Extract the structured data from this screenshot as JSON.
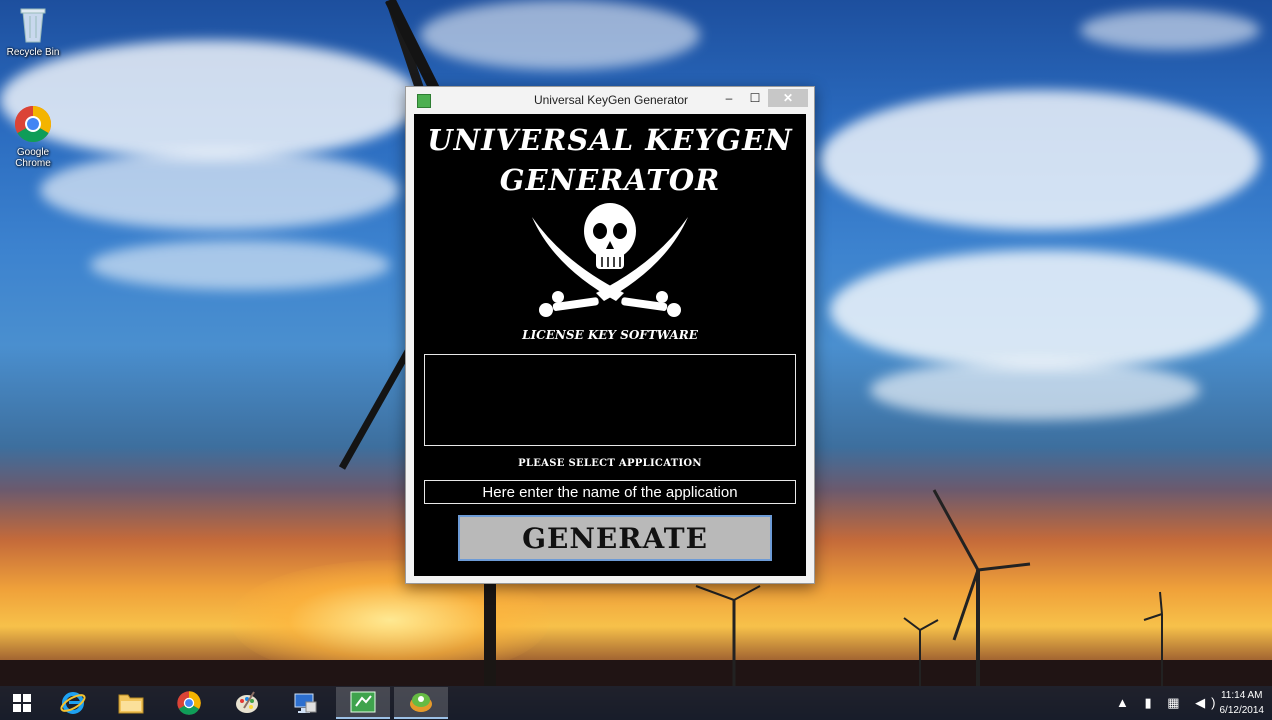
{
  "desktop": {
    "icons": [
      {
        "label": "Recycle Bin",
        "icon": "recycle-bin-icon"
      },
      {
        "label": "Google Chrome",
        "icon": "chrome-icon"
      }
    ]
  },
  "window": {
    "title": "Universal KeyGen Generator",
    "controls": {
      "minimize": "–",
      "maximize": "☐",
      "close": "✕"
    },
    "app_title_line1": "UNIVERSAL KEYGEN",
    "app_title_line2": "GENERATOR",
    "logo": "skull-crossed-swords-icon",
    "logo_caption": "LICENSE KEY SOFTWARE",
    "output_value": "",
    "select_label": "PLEASE SELECT APPLICATION",
    "app_input": {
      "value": "Here enter the name of the application",
      "placeholder": "Here enter the name of the application"
    },
    "generate_label": "GENERATE"
  },
  "taskbar": {
    "items": [
      {
        "name": "start",
        "icon": "windows-logo-icon",
        "active": false
      },
      {
        "name": "internet-explorer",
        "icon": "internet-explorer-icon",
        "active": false
      },
      {
        "name": "file-explorer",
        "icon": "folder-icon",
        "active": false
      },
      {
        "name": "chrome",
        "icon": "chrome-icon",
        "active": false
      },
      {
        "name": "paint",
        "icon": "palette-icon",
        "active": false
      },
      {
        "name": "remote-desktop",
        "icon": "computer-icon",
        "active": false
      },
      {
        "name": "keygen",
        "icon": "keygen-app-icon",
        "active": true
      },
      {
        "name": "app",
        "icon": "green-app-icon",
        "active": true
      }
    ],
    "tray": {
      "time": "11:14 AM",
      "date": "6/12/2014"
    }
  },
  "colors": {
    "window_client": "#000000",
    "button_face": "#b9b9b9",
    "button_border": "#6d9bd6",
    "taskbar": "#161e2c",
    "close_button": "#c7c7c7"
  }
}
